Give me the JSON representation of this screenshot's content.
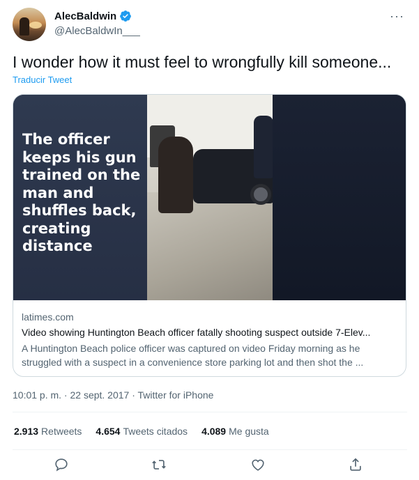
{
  "tweet": {
    "author_name": "AlecBaldwin",
    "author_handle": "@AlecBaldwIn___",
    "text": "I wonder how it must feel to wrongfully kill someone...",
    "translate_label": "Traducir Tweet",
    "more_label": "···"
  },
  "card": {
    "overlay_text": "The officer keeps his gun trained on the man and shuffles back, creating distance",
    "domain": "latimes.com",
    "title": "Video showing Huntington Beach officer fatally shooting suspect outside 7-Elev...",
    "description": "A Huntington Beach police officer was captured on video Friday morning as he struggled with a suspect in a convenience store parking lot and then shot the ..."
  },
  "meta": {
    "line": "10:01 p. m. · 22 sept. 2017 · Twitter for iPhone"
  },
  "stats": {
    "retweets_count": "2.913",
    "retweets_label": "Retweets",
    "quotes_count": "4.654",
    "quotes_label": "Tweets citados",
    "likes_count": "4.089",
    "likes_label": "Me gusta"
  },
  "actions": {
    "icons": [
      "reply-icon",
      "retweet-icon",
      "like-icon",
      "share-icon"
    ]
  },
  "colors": {
    "accent": "#1d9bf0",
    "text_primary": "#0f1419",
    "text_secondary": "#536471",
    "border": "#cfd9de"
  }
}
